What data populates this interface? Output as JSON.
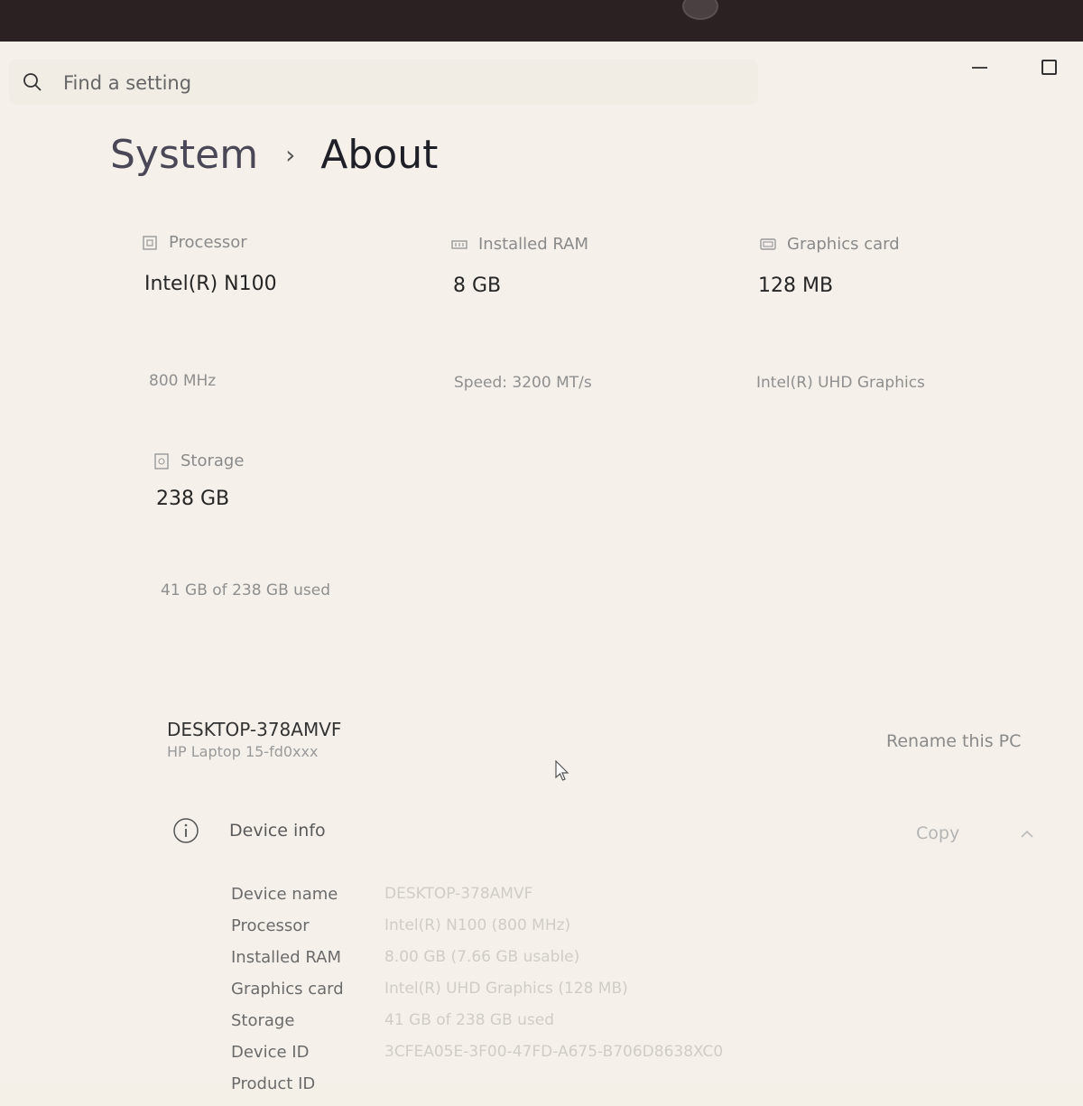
{
  "search": {
    "placeholder": "Find a setting"
  },
  "breadcrumb": {
    "parent": "System",
    "separator": "›",
    "current": "About"
  },
  "specs": [
    {
      "label": "Processor",
      "value": "Intel(R) N100",
      "detail": "800 MHz",
      "icon": "processor-icon"
    },
    {
      "label": "Installed RAM",
      "value": "8 GB",
      "detail": "Speed: 3200 MT/s",
      "icon": "ram-icon"
    },
    {
      "label": "Graphics card",
      "value": "128 MB",
      "detail": "Intel(R) UHD Graphics",
      "icon": "graphics-card-icon"
    },
    {
      "label": "Storage",
      "value": "238 GB",
      "detail": "41 GB of 238 GB used",
      "icon": "storage-icon"
    }
  ],
  "pc": {
    "name": "DESKTOP-378AMVF",
    "model": "HP Laptop 15-fd0xxx",
    "rename_label": "Rename this PC"
  },
  "device_info": {
    "title": "Device info",
    "copy_label": "Copy",
    "rows": [
      {
        "key": "Device name",
        "value": "DESKTOP-378AMVF"
      },
      {
        "key": "Processor",
        "value": "Intel(R) N100 (800 MHz)"
      },
      {
        "key": "Installed RAM",
        "value": "8.00 GB (7.66 GB usable)"
      },
      {
        "key": "Graphics card",
        "value": "Intel(R) UHD Graphics (128 MB)"
      },
      {
        "key": "Storage",
        "value": "41 GB of 238 GB used"
      },
      {
        "key": "Device ID",
        "value": "3CFEA05E-3F00-47FD-A675-B706D8638XC0"
      },
      {
        "key": "Product ID",
        "value": ""
      }
    ]
  },
  "colors": {
    "background": "#f5f1ea",
    "bezel": "#2b2122",
    "text": "#262626",
    "muted": "#8a8a8a"
  }
}
